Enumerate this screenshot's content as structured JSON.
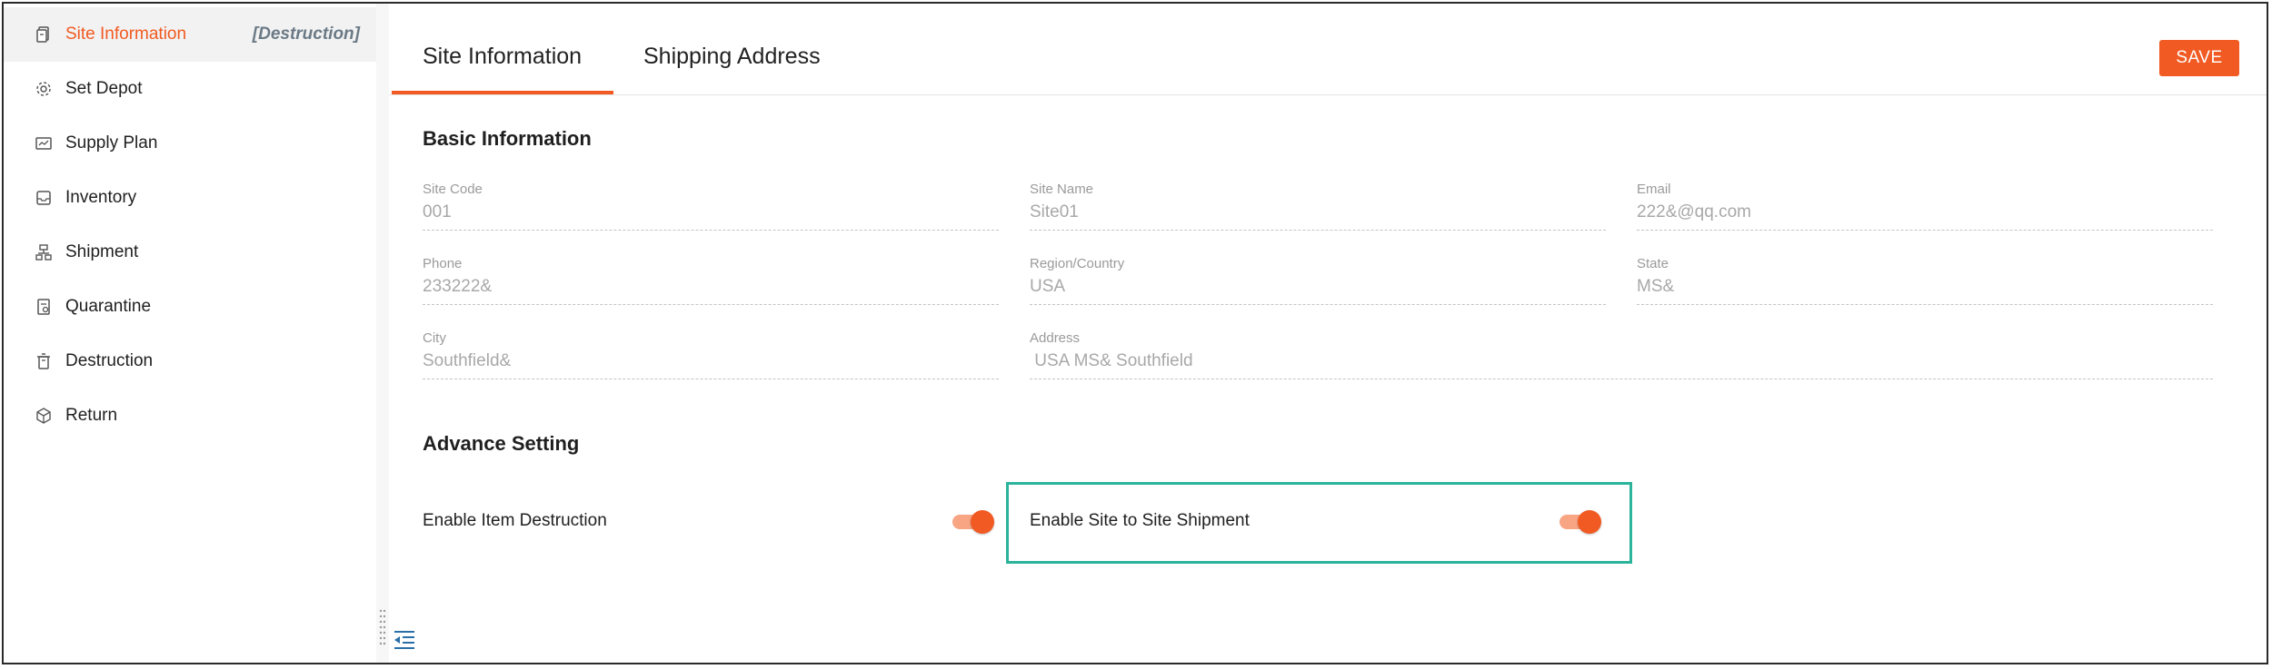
{
  "sidebar": {
    "items": [
      {
        "label": "Site Information",
        "tag": "[Destruction]",
        "icon": "document-icon"
      },
      {
        "label": "Set Depot",
        "icon": "gear-icon"
      },
      {
        "label": "Supply Plan",
        "icon": "calendar-icon"
      },
      {
        "label": "Inventory",
        "icon": "inbox-icon"
      },
      {
        "label": "Shipment",
        "icon": "shipment-icon"
      },
      {
        "label": "Quarantine",
        "icon": "quarantine-icon"
      },
      {
        "label": "Destruction",
        "icon": "trash-icon"
      },
      {
        "label": "Return",
        "icon": "package-icon"
      }
    ]
  },
  "tabs": [
    {
      "label": "Site Information"
    },
    {
      "label": "Shipping Address"
    }
  ],
  "toolbar": {
    "save_label": "SAVE"
  },
  "basic": {
    "title": "Basic Information",
    "fields": [
      {
        "label": "Site Code",
        "value": "001"
      },
      {
        "label": "Site Name",
        "value": "Site01"
      },
      {
        "label": "Email",
        "value": "222&@qq.com"
      },
      {
        "label": "Phone",
        "value": "233222&"
      },
      {
        "label": "Region/Country",
        "value": "USA"
      },
      {
        "label": "State",
        "value": "MS&"
      },
      {
        "label": "City",
        "value": "Southfield&"
      },
      {
        "label": "Address",
        "value": " USA MS& Southfield"
      }
    ]
  },
  "advance": {
    "title": "Advance Setting",
    "settings": [
      {
        "label": "Enable Item Destruction",
        "enabled": true
      },
      {
        "label": "Enable Site to Site Shipment",
        "enabled": true
      }
    ]
  },
  "colors": {
    "accent": "#f15a22",
    "highlight": "#2bb39b"
  }
}
